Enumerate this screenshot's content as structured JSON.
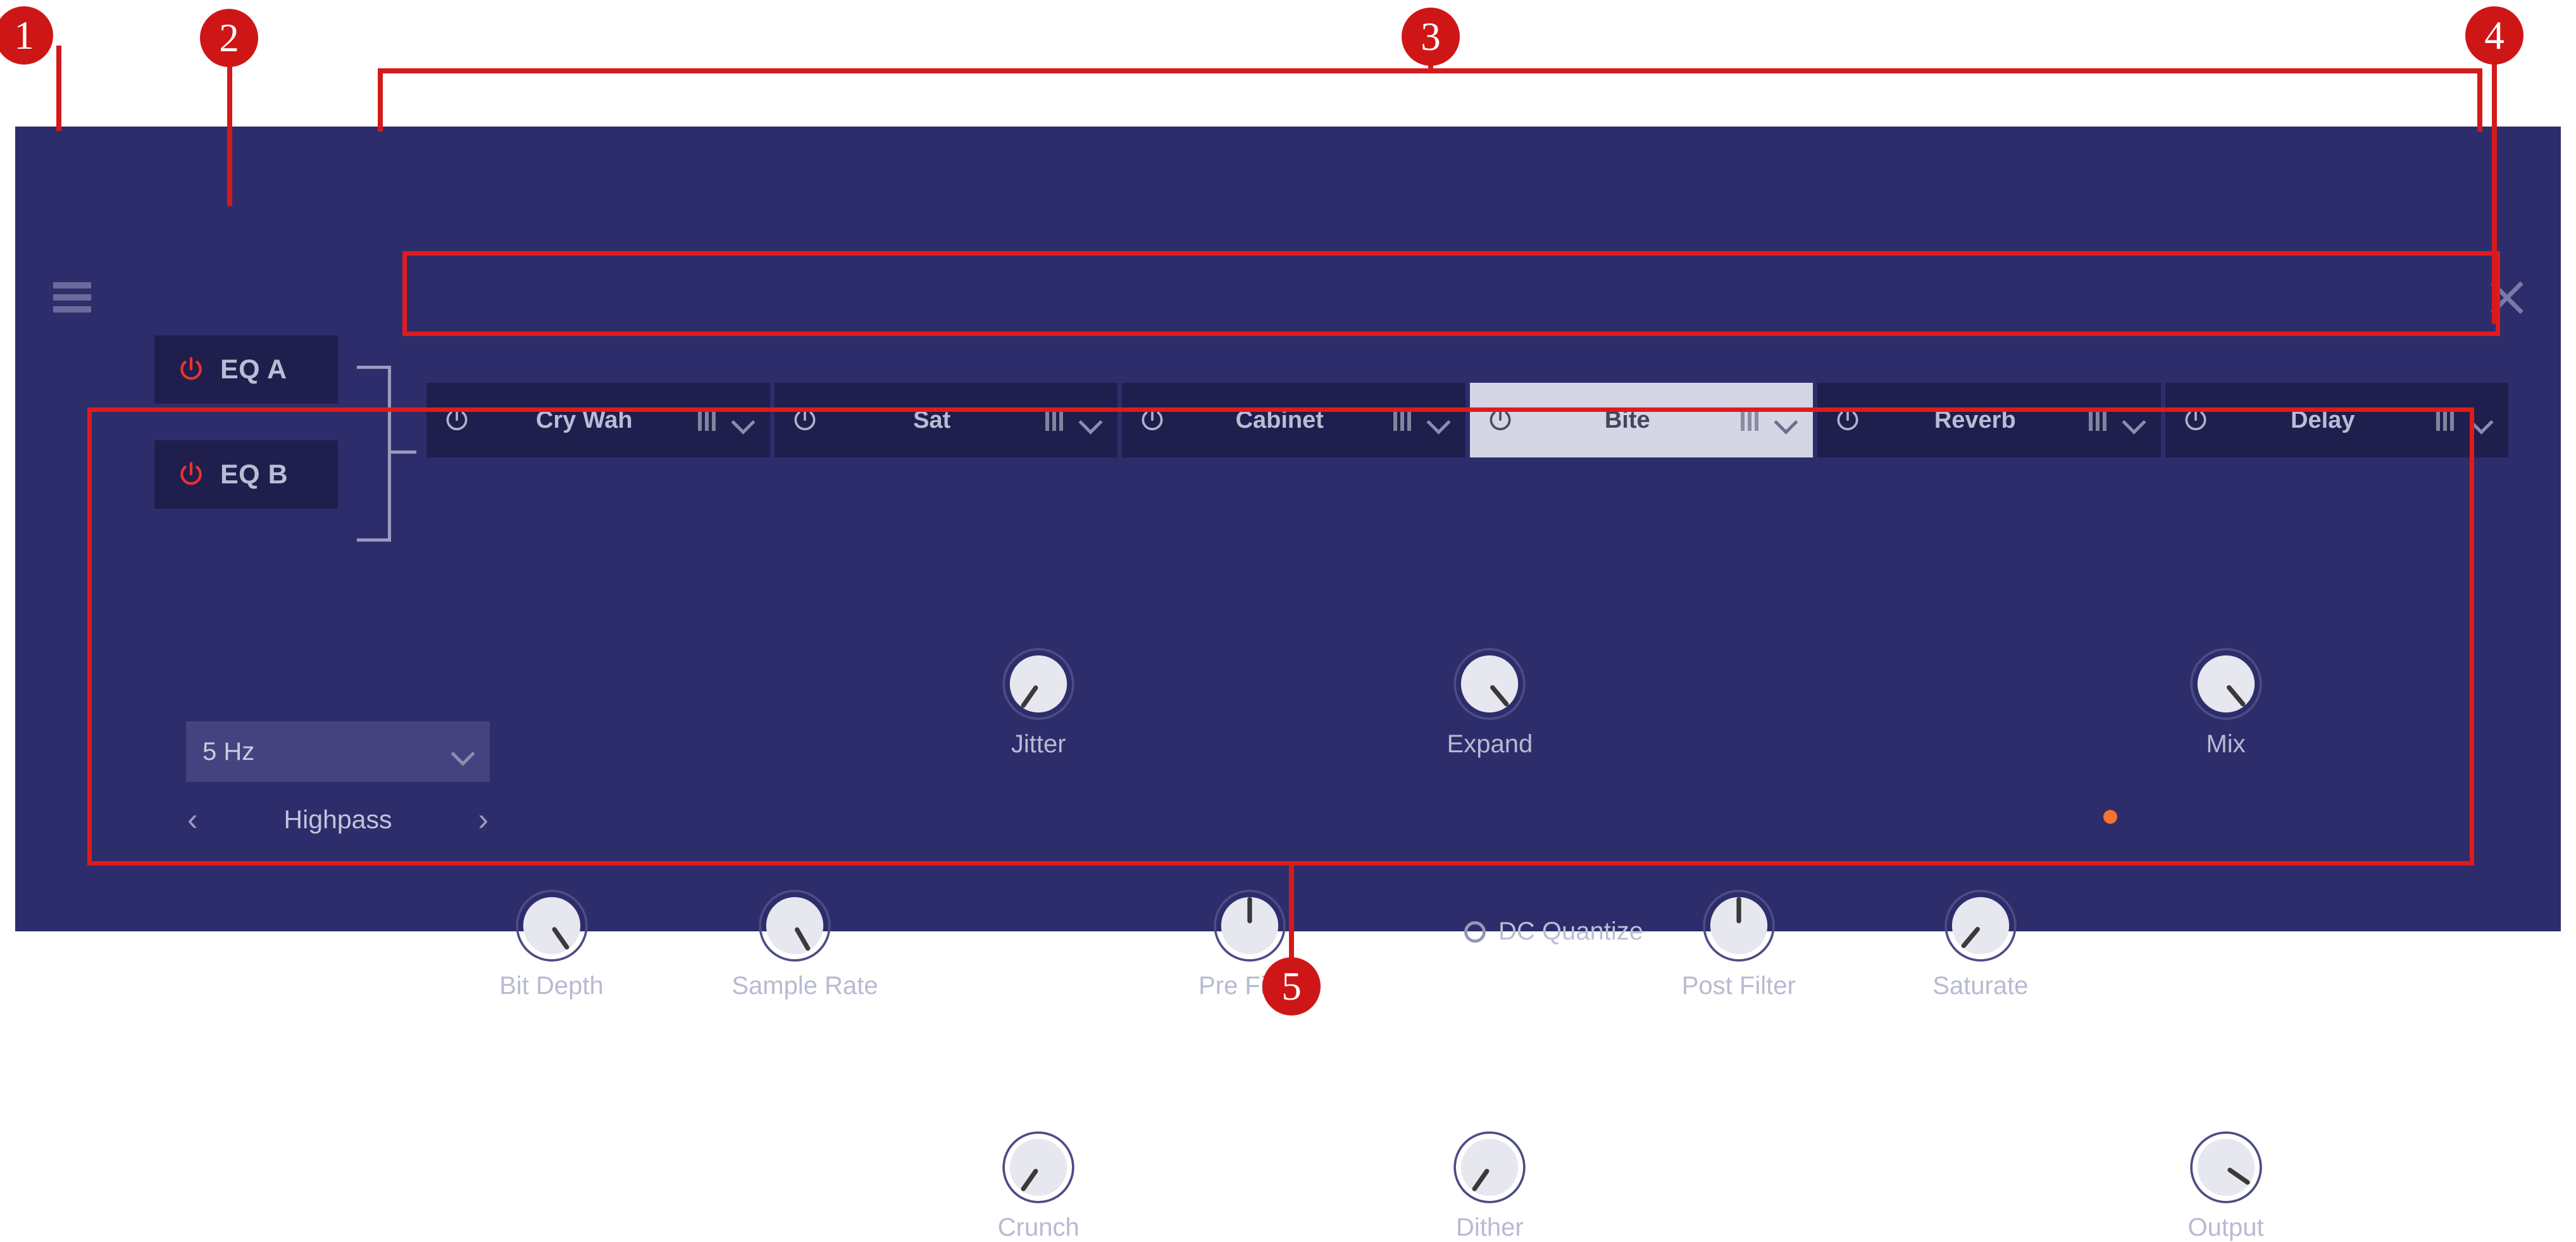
{
  "window": {
    "menu_icon": "hamburger-menu-icon",
    "close_icon": "close-icon"
  },
  "eq_buttons": [
    {
      "label": "EQ A",
      "icon": "power-icon",
      "enabled": false
    },
    {
      "label": "EQ B",
      "icon": "power-icon",
      "enabled": false
    }
  ],
  "fx_chain": [
    {
      "label": "Cry Wah",
      "icon": "power-icon",
      "grip": "drag-handle-icon",
      "chevron": "chevron-down-icon",
      "selected": false
    },
    {
      "label": "Sat",
      "icon": "power-icon",
      "grip": "drag-handle-icon",
      "chevron": "chevron-down-icon",
      "selected": false
    },
    {
      "label": "Cabinet",
      "icon": "power-icon",
      "grip": "drag-handle-icon",
      "chevron": "chevron-down-icon",
      "selected": false
    },
    {
      "label": "Bite",
      "icon": "power-icon",
      "grip": "drag-handle-icon",
      "chevron": "chevron-down-icon",
      "selected": true
    },
    {
      "label": "Reverb",
      "icon": "power-icon",
      "grip": "drag-handle-icon",
      "chevron": "chevron-down-icon",
      "selected": false
    },
    {
      "label": "Delay",
      "icon": "power-icon",
      "grip": "drag-handle-icon",
      "chevron": "chevron-down-icon",
      "selected": false
    }
  ],
  "filter": {
    "frequency_value": "5 Hz",
    "chevron": "chevron-down-icon",
    "mode": "Highpass",
    "prev_arrow": "‹",
    "next_arrow": "›"
  },
  "knobs": [
    {
      "label": "Bit Depth",
      "angle": 145
    },
    {
      "label": "Sample Rate",
      "angle": 150
    },
    {
      "label": "Jitter",
      "angle": 215
    },
    {
      "label": "Crunch",
      "angle": 215
    },
    {
      "label": "Pre Filter",
      "angle": 0
    },
    {
      "label": "Expand",
      "angle": 140
    },
    {
      "label": "Dither",
      "angle": 215
    },
    {
      "label": "Post Filter",
      "angle": 0
    },
    {
      "label": "Saturate",
      "angle": 220
    },
    {
      "label": "Mix",
      "angle": 140
    },
    {
      "label": "Output",
      "angle": 125
    }
  ],
  "dc_quantize": {
    "label": "DC Quantize",
    "icon": "radio-circle-icon",
    "checked": false
  },
  "output_led": {
    "name": "output-led",
    "color": "#f4742b",
    "on": true
  },
  "callouts": [
    {
      "number": "1"
    },
    {
      "number": "2"
    },
    {
      "number": "3"
    },
    {
      "number": "4"
    },
    {
      "number": "5"
    }
  ],
  "colors": {
    "panel_bg": "#2e2d6b",
    "slot_bg": "#1f1e4d",
    "selected_slot_bg": "#d4d6e4",
    "accent_red": "#e01b1b",
    "power_red": "#e8342e",
    "led_orange": "#f4742b",
    "text": "#b9bcd4"
  }
}
